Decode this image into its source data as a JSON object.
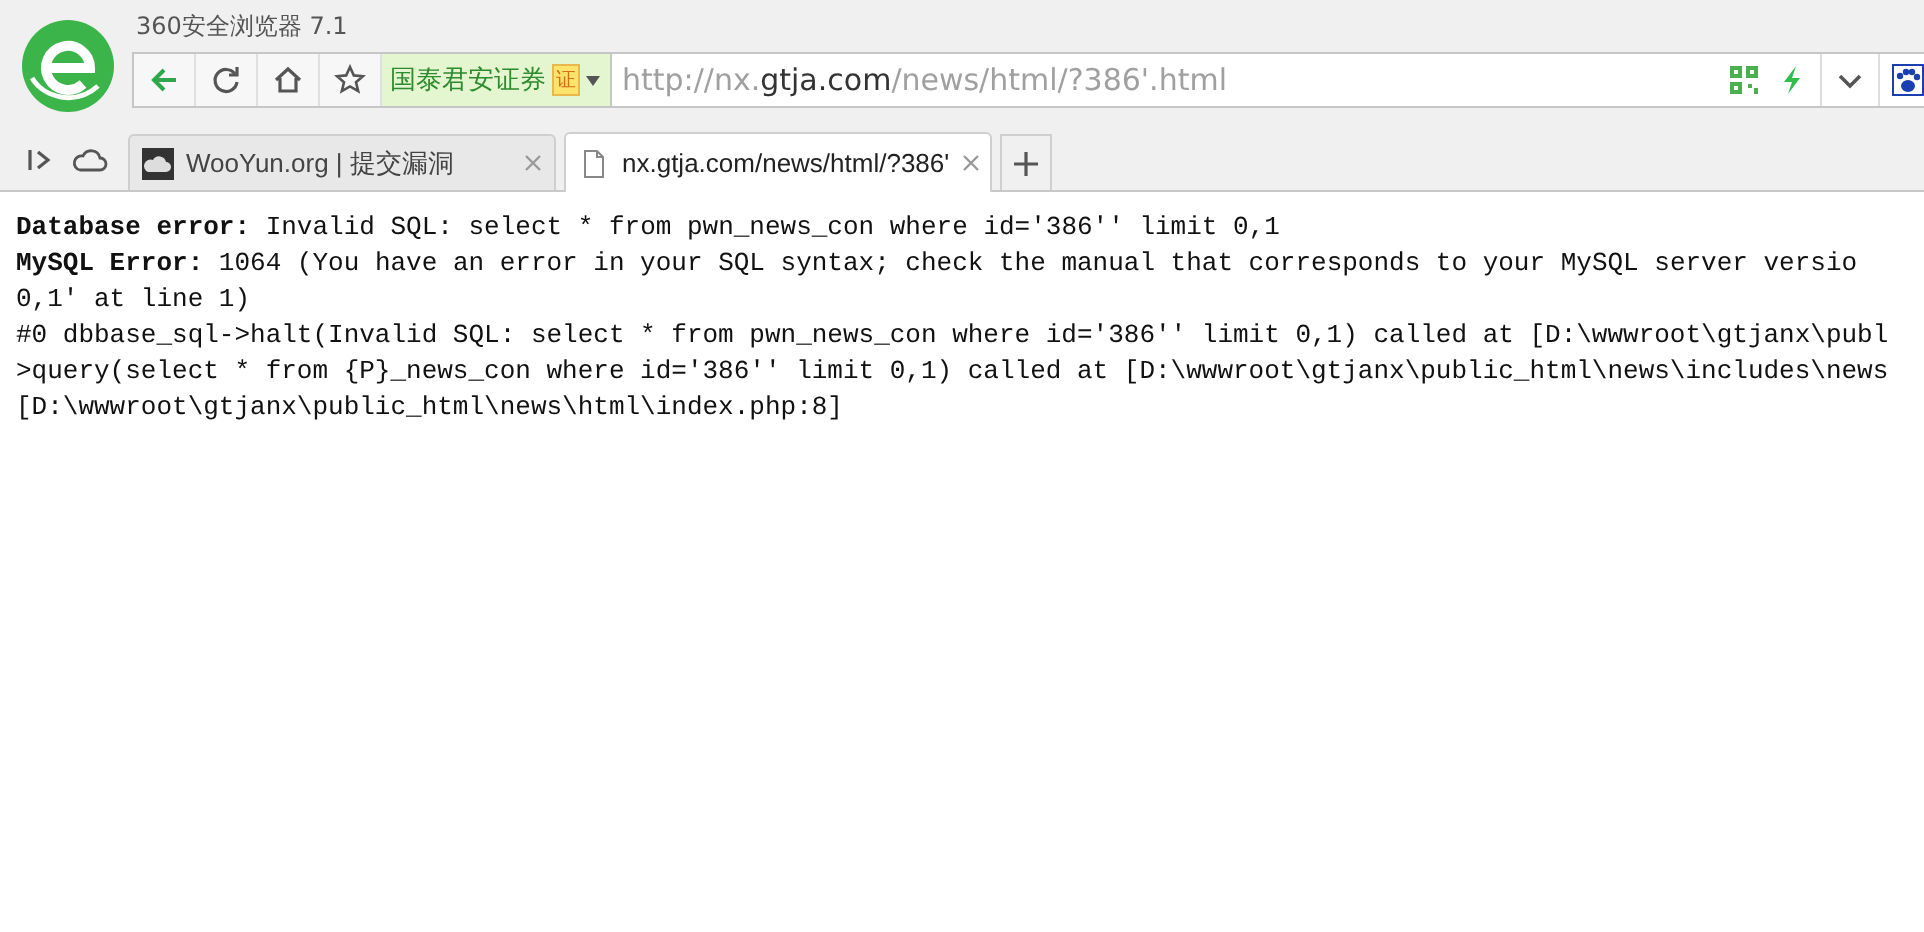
{
  "window": {
    "title": "360安全浏览器 7.1"
  },
  "toolbar": {
    "site_badge": {
      "label": "国泰君安证券",
      "cert": "证"
    },
    "address": [
      {
        "text": "http://nx.",
        "emphasis": false
      },
      {
        "text": "gtja.com",
        "emphasis": true
      },
      {
        "text": "/news/html/?386'.html",
        "emphasis": false
      }
    ]
  },
  "tabs": [
    {
      "title": "WooYun.org | 提交漏洞",
      "kind": "site",
      "selected": false
    },
    {
      "title": "nx.gtja.com/news/html/?386'",
      "kind": "page",
      "selected": true
    }
  ],
  "page": {
    "lines": [
      "**Database error:** Invalid SQL: select * from pwn_news_con where id='386'' limit 0,1",
      "**MySQL Error:** 1064 (You have an error in your SQL syntax; check the manual that corresponds to your MySQL server versio",
      "0,1' at line 1)",
      "#0 dbbase_sql->halt(Invalid SQL: select * from pwn_news_con where id='386'' limit 0,1) called at [D:\\wwwroot\\gtjanx\\publ",
      ">query(select * from {P}_news_con where id='386'' limit 0,1) called at [D:\\wwwroot\\gtjanx\\public_html\\news\\includes\\news",
      "[D:\\wwwroot\\gtjanx\\public_html\\news\\html\\index.php:8]"
    ]
  }
}
